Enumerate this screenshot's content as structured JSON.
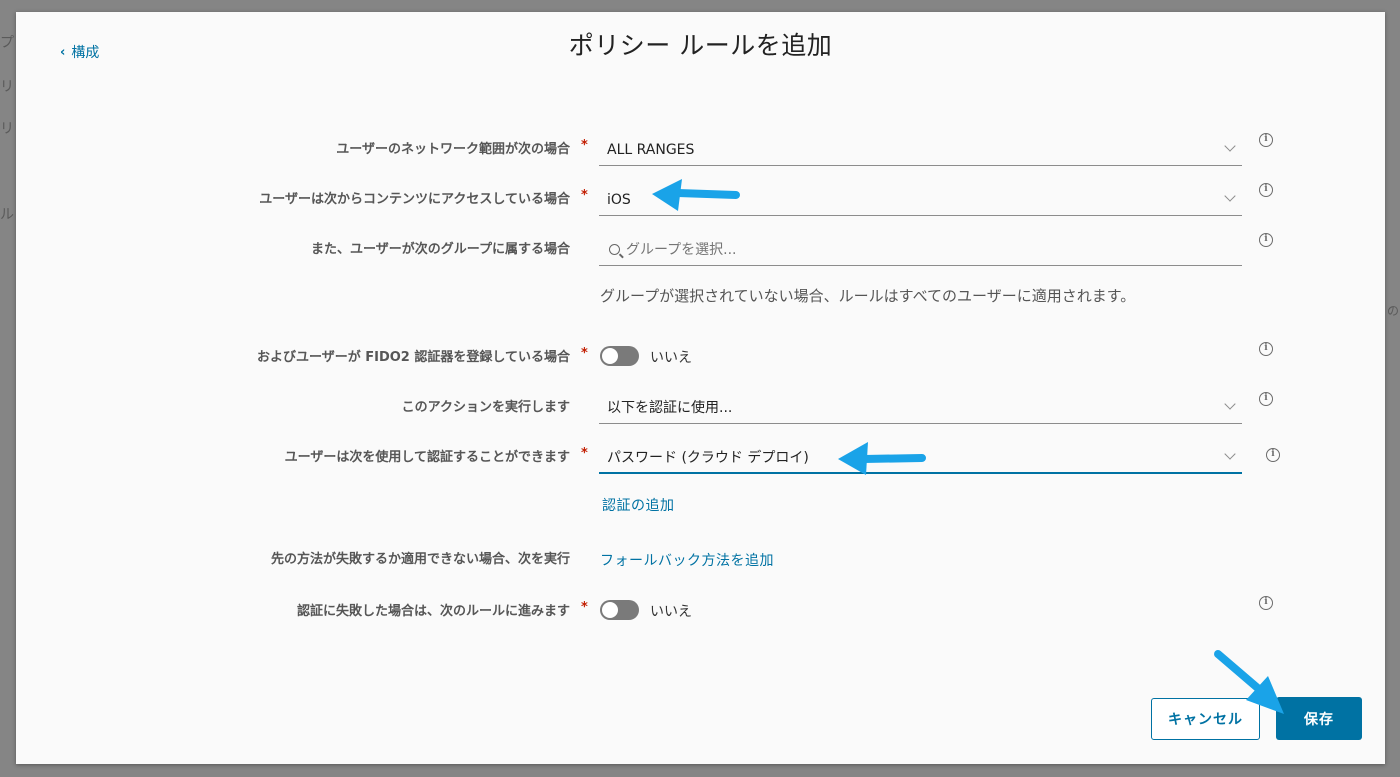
{
  "background": {
    "fragments": [
      "プ",
      "リ",
      "リ",
      "ル",
      "の"
    ]
  },
  "header": {
    "back_label": "構成",
    "title": "ポリシー ルールを追加"
  },
  "form": {
    "network_range": {
      "label": "ユーザーのネットワーク範囲が次の場合",
      "value": "ALL RANGES",
      "required": true
    },
    "device_type": {
      "label": "ユーザーは次からコンテンツにアクセスしている場合",
      "value": "iOS",
      "required": true
    },
    "group": {
      "label": "また、ユーザーが次のグループに属する場合",
      "placeholder": "グループを選択...",
      "help": "グループが選択されていない場合、ルールはすべてのユーザーに適用されます。"
    },
    "fido2": {
      "label": "およびユーザーが FIDO2 認証器を登録している場合",
      "toggle_label": "いいえ",
      "required": true
    },
    "action": {
      "label": "このアクションを実行します",
      "value": "以下を認証に使用..."
    },
    "auth_method": {
      "label": "ユーザーは次を使用して認証することができます",
      "value": "パスワード (クラウド デプロイ)",
      "required": true,
      "add_link": "認証の追加"
    },
    "fallback": {
      "label": "先の方法が失敗するか適用できない場合、次を実行",
      "link": "フォールバック方法を追加"
    },
    "next_rule": {
      "label": "認証に失敗した場合は、次のルールに進みます",
      "toggle_label": "いいえ",
      "required": true
    },
    "required_marker": "*",
    "info_icon_glyph": "i"
  },
  "footer": {
    "cancel_label": "キャンセル",
    "save_label": "保存"
  },
  "colors": {
    "accent": "#0072a3",
    "annotation_arrow": "#1aa3e8",
    "required": "#c21d00"
  }
}
